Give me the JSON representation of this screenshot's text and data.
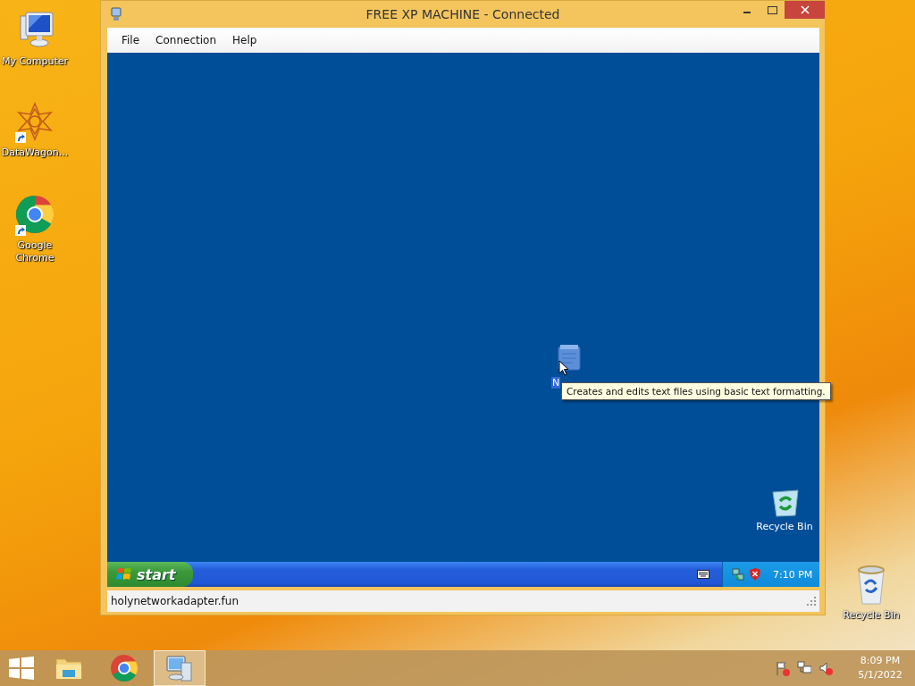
{
  "desktop_icons": [
    {
      "label": "My Computer",
      "kind": "computer",
      "shortcut": false
    },
    {
      "label": "DataWagon...",
      "kind": "star",
      "shortcut": true
    },
    {
      "label": "Google Chrome",
      "kind": "chrome",
      "shortcut": true
    }
  ],
  "recycle_bin": {
    "label": "Recycle Bin"
  },
  "window": {
    "title": "FREE XP MACHINE - Connected",
    "menu": [
      "File",
      "Connection",
      "Help"
    ],
    "remote_desktop": {
      "icons": [
        {
          "label": "N",
          "kind": "notepad"
        },
        {
          "label": "Recycle Bin",
          "kind": "recycle"
        }
      ],
      "tooltip": "Creates and edits text files using basic text formatting.",
      "taskbar": {
        "start": "start",
        "clock": "7:10 PM"
      }
    },
    "status_bar": "holynetworkadapter.fun"
  },
  "taskbar": {
    "apps": [
      {
        "kind": "explorer",
        "selected": false
      },
      {
        "kind": "chrome",
        "selected": false
      },
      {
        "kind": "remote",
        "selected": true
      }
    ],
    "tray": [
      {
        "kind": "flag"
      },
      {
        "kind": "network"
      },
      {
        "kind": "volume"
      }
    ],
    "time": "8:09 PM",
    "date": "5/1/2022"
  }
}
